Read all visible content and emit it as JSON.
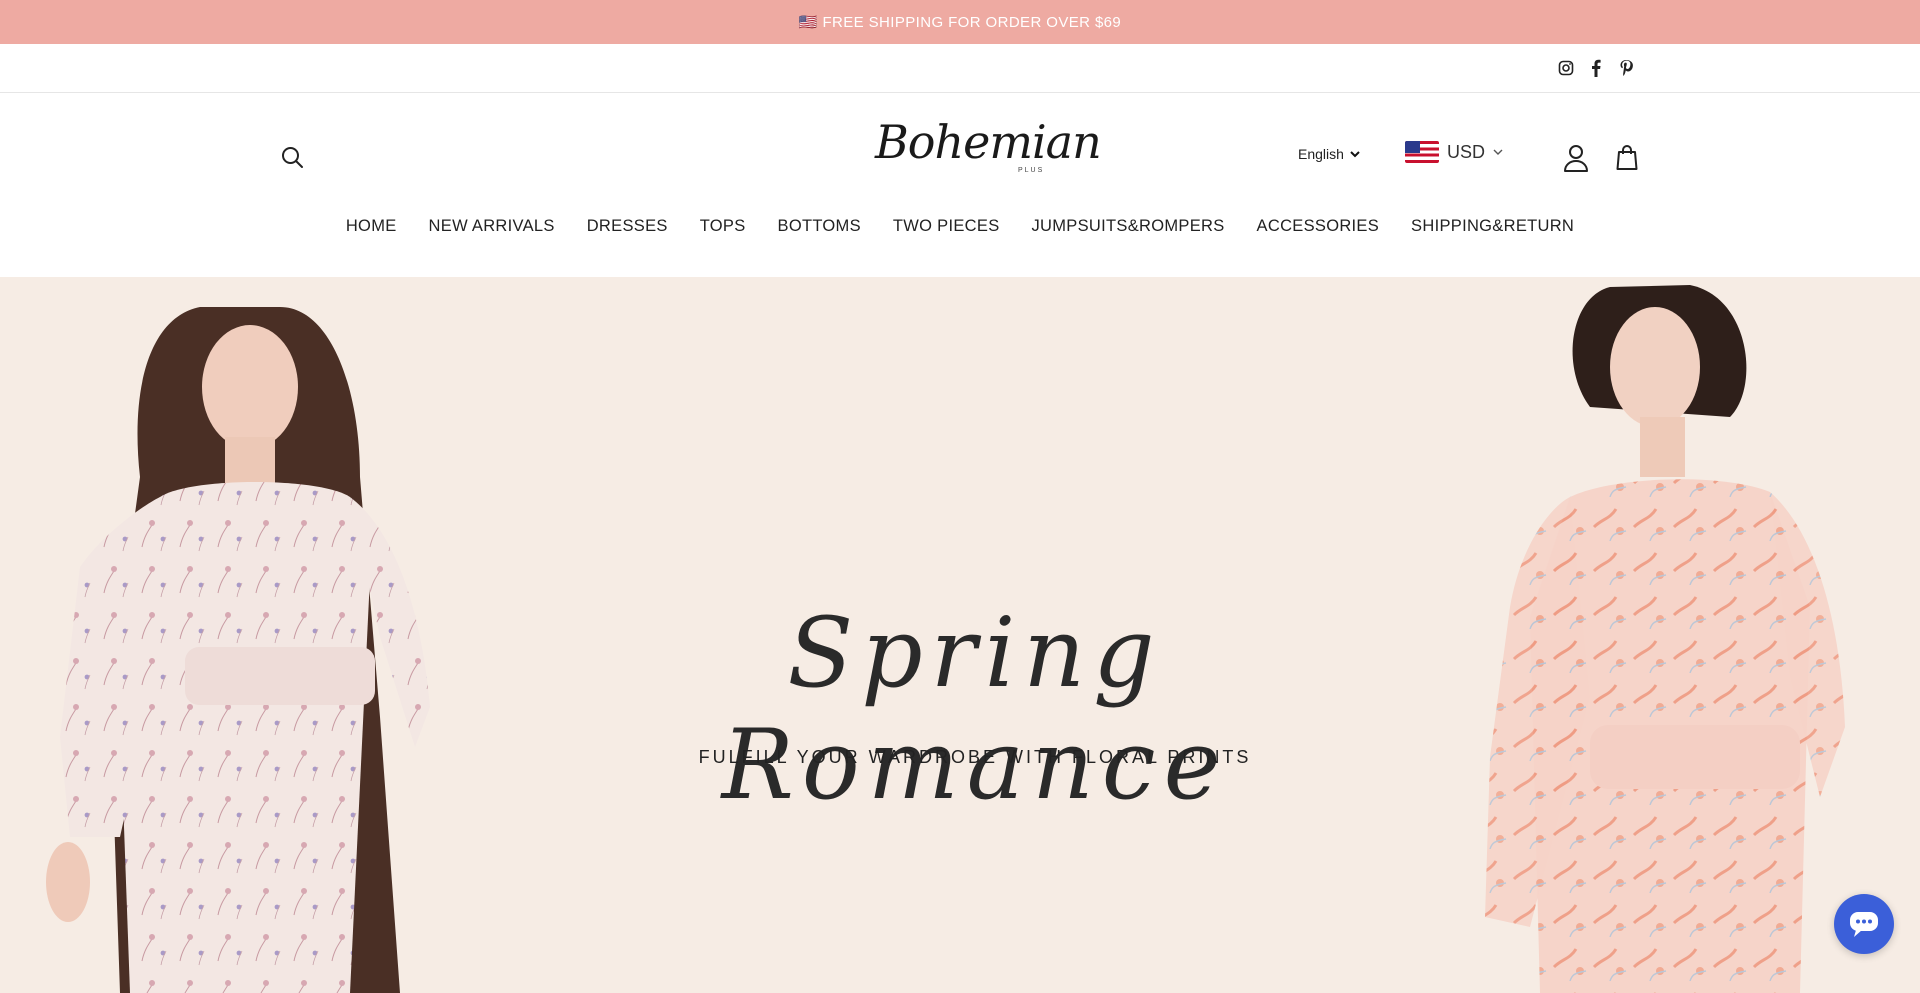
{
  "announcement": {
    "text": "🇺🇸 FREE SHIPPING FOR ORDER OVER $69"
  },
  "social": {
    "icons": [
      "instagram-icon",
      "facebook-icon",
      "pinterest-icon"
    ]
  },
  "header": {
    "logo_text": "Bohemian",
    "logo_sub": "PLUS",
    "language": "English",
    "currency": "USD"
  },
  "nav": {
    "items": [
      "HOME",
      "NEW ARRIVALS",
      "DRESSES",
      "TOPS",
      "BOTTOMS",
      "TWO PIECES",
      "JUMPSUITS&ROMPERS",
      "ACCESSORIES",
      "SHIPPING&RETURN"
    ]
  },
  "hero": {
    "title": "Spring Romance",
    "subtitle": "FULFILL YOUR WARDROBE WITH FLORAL PRINTS"
  },
  "colors": {
    "announcement_bg": "#eeaaa2",
    "hero_bg": "#f6ece4",
    "chat_button": "#3b5fd9"
  }
}
